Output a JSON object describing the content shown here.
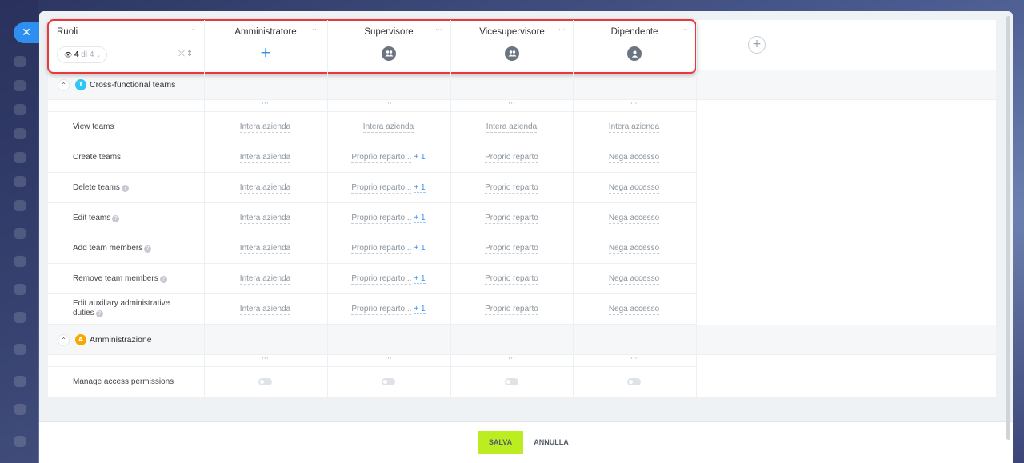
{
  "close_icon": "close-icon",
  "header": {
    "roles_title": "Ruoli",
    "visible_count": "4",
    "visible_of": "di 4",
    "roles": [
      {
        "name": "Amministratore",
        "icon": "plus-icon"
      },
      {
        "name": "Supervisore",
        "icon": "group-icon"
      },
      {
        "name": "Vicesupervisore",
        "icon": "group-icon"
      },
      {
        "name": "Dipendente",
        "icon": "user-icon"
      }
    ],
    "add_role_icon": "plus-icon",
    "menu_dots": "···"
  },
  "sections": [
    {
      "title": "Cross-functional teams",
      "icon_color": "#2fc6f6",
      "icon_glyph": "T",
      "permissions": [
        {
          "label": "View teams",
          "help": false,
          "values": [
            "Intera azienda",
            "Intera azienda",
            "Intera azienda",
            "Intera azienda"
          ],
          "extra": [
            "",
            "",
            "",
            ""
          ]
        },
        {
          "label": "Create teams",
          "help": false,
          "values": [
            "Intera azienda",
            "Proprio reparto...",
            "Proprio reparto",
            "Nega accesso"
          ],
          "extra": [
            "",
            "+ 1",
            "",
            ""
          ]
        },
        {
          "label": "Delete teams",
          "help": true,
          "values": [
            "Intera azienda",
            "Proprio reparto...",
            "Proprio reparto",
            "Nega accesso"
          ],
          "extra": [
            "",
            "+ 1",
            "",
            ""
          ]
        },
        {
          "label": "Edit teams",
          "help": true,
          "values": [
            "Intera azienda",
            "Proprio reparto...",
            "Proprio reparto",
            "Nega accesso"
          ],
          "extra": [
            "",
            "+ 1",
            "",
            ""
          ]
        },
        {
          "label": "Add team members",
          "help": true,
          "values": [
            "Intera azienda",
            "Proprio reparto...",
            "Proprio reparto",
            "Nega accesso"
          ],
          "extra": [
            "",
            "+ 1",
            "",
            ""
          ]
        },
        {
          "label": "Remove team members",
          "help": true,
          "values": [
            "Intera azienda",
            "Proprio reparto...",
            "Proprio reparto",
            "Nega accesso"
          ],
          "extra": [
            "",
            "+ 1",
            "",
            ""
          ]
        },
        {
          "label": "Edit auxiliary administrative duties",
          "help": true,
          "values": [
            "Intera azienda",
            "Proprio reparto...",
            "Proprio reparto",
            "Nega accesso"
          ],
          "extra": [
            "",
            "+ 1",
            "",
            ""
          ]
        }
      ]
    },
    {
      "title": "Amministrazione",
      "icon_color": "#f7a700",
      "icon_glyph": "A",
      "permissions": [
        {
          "label": "Manage access permissions",
          "help": false,
          "toggles": [
            false,
            false,
            false,
            false
          ]
        }
      ]
    }
  ],
  "footer": {
    "save_label": "SALVA",
    "cancel_label": "ANNULLA"
  },
  "colors": {
    "accent": "#2f8ff0",
    "save": "#bbed21",
    "highlight": "#e8383d"
  }
}
